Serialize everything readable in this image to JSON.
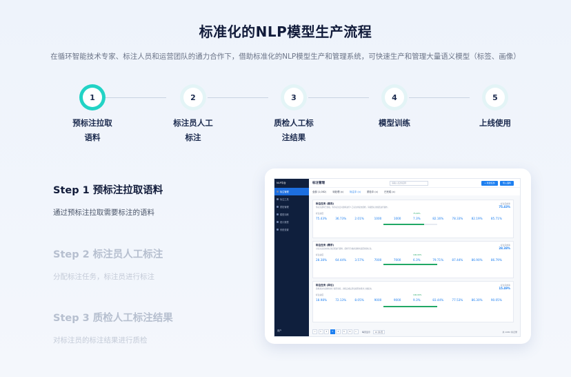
{
  "page": {
    "title": "标准化的NLP模型生产流程",
    "subtitle": "在循环智能技术专家、标注人员和运营团队的通力合作下，借助标准化的NLP模型生产和管理系统，可快速生产和管理大量语义模型（标签、画像）"
  },
  "steps": [
    {
      "num": "1",
      "line1": "预标注拉取",
      "line2": "语料"
    },
    {
      "num": "2",
      "line1": "标注员人工",
      "line2": "标注"
    },
    {
      "num": "3",
      "line1": "质检人工标",
      "line2": "注结果"
    },
    {
      "num": "4",
      "line1": "模型训练",
      "line2": ""
    },
    {
      "num": "5",
      "line1": "上线使用",
      "line2": ""
    }
  ],
  "descriptions": [
    {
      "title": "Step 1  预标注拉取语料",
      "text": "通过预标注拉取需要标注的语料"
    },
    {
      "title": "Step 2  标注员人工标注",
      "text": "分配标注任务，标注员进行标注"
    },
    {
      "title": "Step 3  质检人工标注结果",
      "text": "对标注员的标注结果进行质检"
    }
  ],
  "app": {
    "logo": "NLP平台",
    "header": "标注管理",
    "search_placeholder": "请输入任务名称",
    "btn_a": "+ 新建任务",
    "btn_b": "导入语料",
    "sidebar": [
      "标注管理",
      "标注工具",
      "质检管理",
      "模型训练",
      "统计报表",
      "系统设置"
    ],
    "sidebar_foot": "用户",
    "tabs": [
      "全部 (1,082)",
      "待处理 (x)",
      "标注中 (x)",
      "质检中 (x)",
      "已完成 (x)"
    ],
    "tasks": [
      {
        "title": "标注任务 (意向)",
        "desc": "预标注语料已拉取，等待标注员对语料进行人工标注并提交质检，请按照标注规范进行操作。",
        "right_label": "标注完成率",
        "right_value": "75.43%",
        "progress_label": "标注进度",
        "progress_value": "75.00%",
        "progress": 0.75,
        "stats": [
          "75.43%",
          "36.73%",
          "2.01%",
          "1000",
          "1000",
          "7.3%",
          "82.16%",
          "78.33%",
          "82.19%",
          "85.71%"
        ]
      },
      {
        "title": "标注任务 (需求)",
        "desc": "对标注员提交的标注结果进行质检，质检不合格的语料将退回重新标注。",
        "right_label": "标注完成率",
        "right_value": "28.38%",
        "progress_label": "标注进度",
        "progress_value": "100.00%",
        "progress": 1.0,
        "stats": [
          "28.38%",
          "64.44%",
          "3.57%",
          "7000",
          "7000",
          "6.3%",
          "79.71%",
          "87.44%",
          "86.90%",
          "86.79%"
        ]
      },
      {
        "title": "标注任务 (异议)",
        "desc": "质检通过的语料将用于模型训练，训练完成后评估模型效果并上线使用。",
        "right_label": "标注完成率",
        "right_value": "15.49%",
        "progress_label": "标注进度",
        "progress_value": "100.00%",
        "progress": 1.0,
        "stats": [
          "18.98%",
          "72.13%",
          "8.05%",
          "9000",
          "9000",
          "9.3%",
          "83.44%",
          "77.53%",
          "86.30%",
          "90.05%"
        ]
      }
    ],
    "pager": [
      "<",
      "1",
      "2",
      "3",
      "4",
      "5",
      "6",
      ">"
    ],
    "pager_active": "3",
    "pager_size": "每页显示",
    "pager_size_value": "10 条/页",
    "pager_right": "共 1082 条记录"
  },
  "colors": {
    "accent": "#22d3c5",
    "brand": "#1d7ff0",
    "sidebar": "#0f1f3d"
  }
}
